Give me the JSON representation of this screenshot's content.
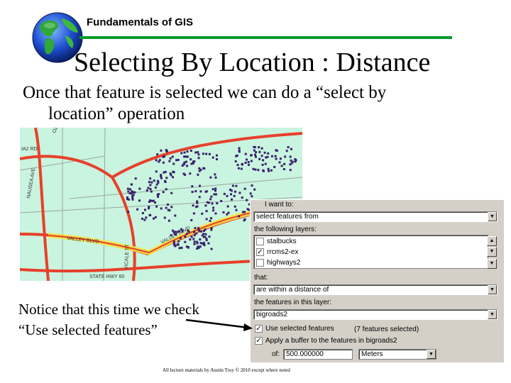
{
  "header": {
    "course_title": "Fundamentals of GIS",
    "slide_title": "Selecting By Location : Distance",
    "rule_color": "#0a9a2a"
  },
  "body": {
    "line1": "Once that feature is selected we can do a “select by",
    "line2": "location” operation"
  },
  "map": {
    "background_color": "#c9f4df",
    "road_color": "#e8402a",
    "highlight_color": "#f2e84a",
    "parcel_color": "#3a1f6e",
    "labels": {
      "top_left_road": "IA2 RD",
      "nausea_ave": "NAUSEA AVE",
      "vicale_st": "VICALE ST",
      "valley_blvd_left": "VALLEY BLVD",
      "valley_blvd_right": "VALLEY BLVD",
      "state_hwy": "STATE HWY 60",
      "top_road": "OZ"
    }
  },
  "note": {
    "line1": "Notice that this time we check",
    "line2": "“Use selected features”"
  },
  "dialog": {
    "want_to_label": "I want to:",
    "method_value": "select features from",
    "layers_label": "the following layers:",
    "layers": [
      {
        "name": "stalbucks",
        "checked": false
      },
      {
        "name": "rrcms2-ex",
        "checked": true
      },
      {
        "name": "highways2",
        "checked": false
      }
    ],
    "that_label": "that:",
    "relation_value": "are within a distance of",
    "features_label": "the features in this layer:",
    "layer_value": "bigroads2",
    "use_selected_label": "Use selected features",
    "use_selected_checked": true,
    "selected_count": "(7 features selected)",
    "buffer_label": "Apply a buffer to the features in bigroads2",
    "buffer_checked": true,
    "of_label": "of:",
    "distance_value": "500.000000",
    "units_value": "Meters"
  },
  "footer": {
    "text": "All lecture materials by Austin Troy © 2010 except where noted"
  }
}
